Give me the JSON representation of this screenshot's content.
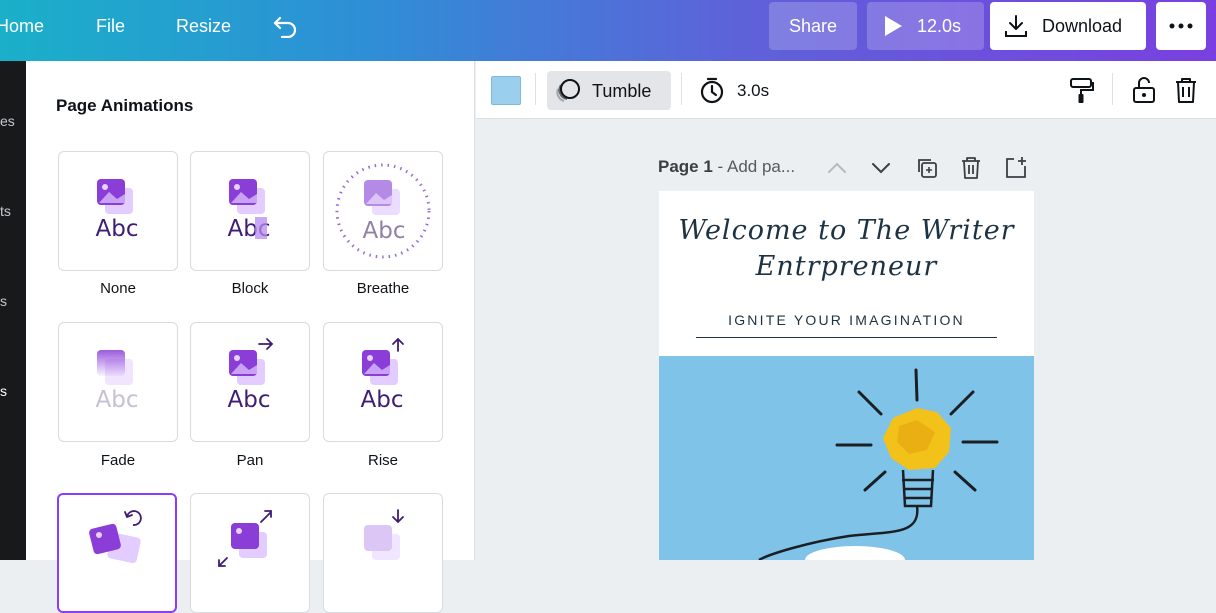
{
  "topbar": {
    "home": "Home",
    "file": "File",
    "resize": "Resize",
    "share": "Share",
    "play_duration": "12.0s",
    "download": "Download"
  },
  "rail": {
    "items": [
      "es",
      "ts",
      "s",
      "s"
    ]
  },
  "panel": {
    "title": "Page Animations",
    "animations": [
      {
        "name": "None"
      },
      {
        "name": "Block"
      },
      {
        "name": "Breathe"
      },
      {
        "name": "Fade"
      },
      {
        "name": "Pan"
      },
      {
        "name": "Rise"
      },
      {
        "name": "Tumble",
        "selected": true
      },
      {
        "name": ""
      },
      {
        "name": ""
      }
    ],
    "preview_text": "Abc"
  },
  "toolbar": {
    "swatch_color": "#9bcfee",
    "animation_label": "Tumble",
    "duration": "3.0s"
  },
  "page_header": {
    "page_number": "Page 1",
    "page_title_placeholder": "- Add pa..."
  },
  "design": {
    "heading_line1": "Welcome to The Writer",
    "heading_line2": "Entrpreneur",
    "tagline": "IGNITE YOUR IMAGINATION"
  },
  "colors": {
    "accent": "#8b3dff",
    "icon_purple": "#7d2ae8"
  }
}
